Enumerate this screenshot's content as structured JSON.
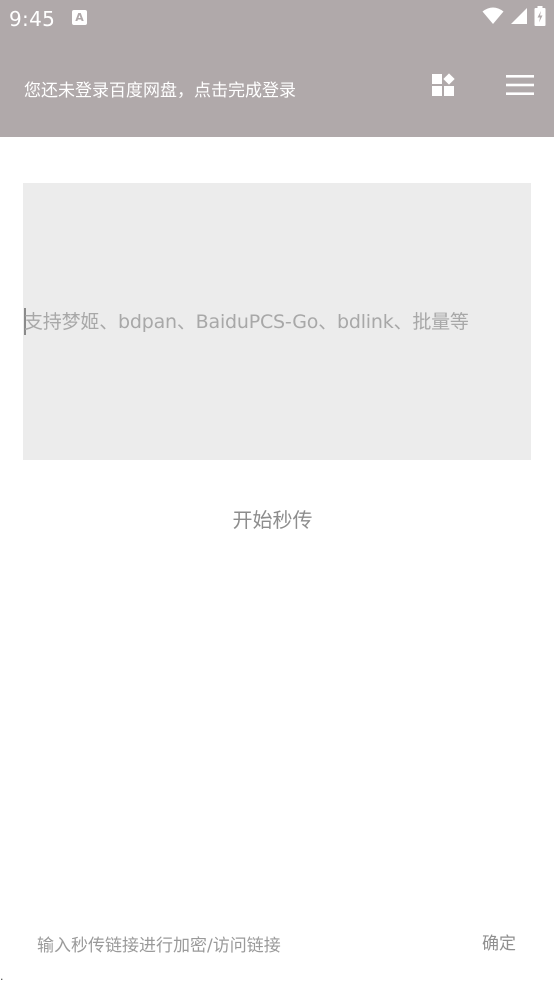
{
  "status_bar": {
    "time": "9:45",
    "notification_icon_letter": "A",
    "icons": [
      "wifi-icon",
      "signal-icon",
      "battery-charging-icon"
    ]
  },
  "app_bar": {
    "title": "您还未登录百度网盘，点击完成登录",
    "actions": [
      "apps-add-icon",
      "menu-icon"
    ],
    "color": "#b0a9aa"
  },
  "main": {
    "link_input_placeholder": "支持梦姬、bdpan、BaiduPCS-Go、bdlink、批量等",
    "start_button_label": "开始秒传"
  },
  "bottom": {
    "encrypt_input_placeholder": "输入秒传链接进行加密/访问链接",
    "confirm_label": "确定",
    "corner_mark": "·"
  }
}
